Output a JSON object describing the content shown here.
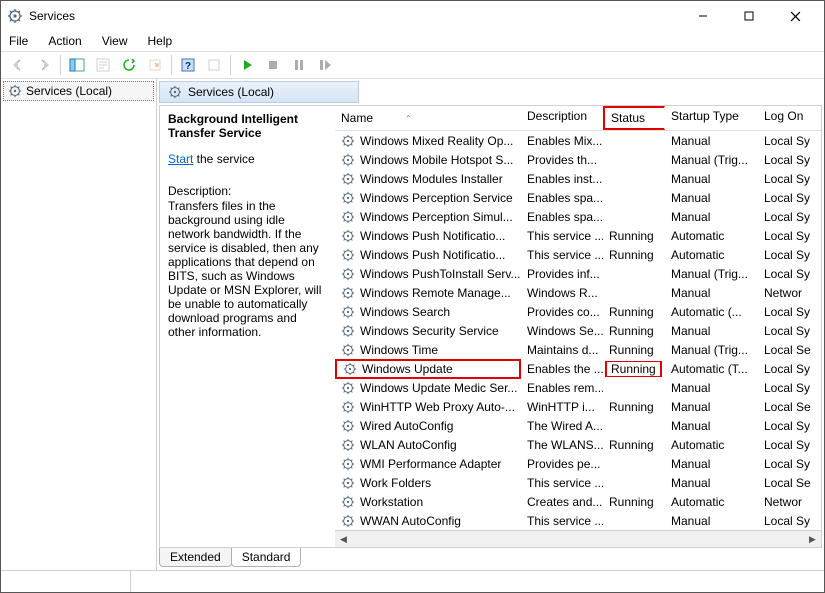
{
  "window": {
    "title": "Services"
  },
  "menu": {
    "file": "File",
    "action": "Action",
    "view": "View",
    "help": "Help"
  },
  "left": {
    "label": "Services (Local)"
  },
  "pane_header": "Services (Local)",
  "detail": {
    "service_name": "Background Intelligent Transfer Service",
    "start_link": "Start",
    "start_suffix": " the service",
    "desc_label": "Description:",
    "desc_text": "Transfers files in the background using idle network bandwidth. If the service is disabled, then any applications that depend on BITS, such as Windows Update or MSN Explorer, will be unable to automatically download programs and other information."
  },
  "columns": {
    "name": "Name",
    "desc": "Description",
    "status": "Status",
    "stype": "Startup Type",
    "logon": "Log On"
  },
  "rows": [
    {
      "name": "Windows Mixed Reality Op...",
      "desc": "Enables Mix...",
      "status": "",
      "stype": "Manual",
      "logon": "Local Sy"
    },
    {
      "name": "Windows Mobile Hotspot S...",
      "desc": "Provides th...",
      "status": "",
      "stype": "Manual (Trig...",
      "logon": "Local Sy"
    },
    {
      "name": "Windows Modules Installer",
      "desc": "Enables inst...",
      "status": "",
      "stype": "Manual",
      "logon": "Local Sy"
    },
    {
      "name": "Windows Perception Service",
      "desc": "Enables spa...",
      "status": "",
      "stype": "Manual",
      "logon": "Local Sy"
    },
    {
      "name": "Windows Perception Simul...",
      "desc": "Enables spa...",
      "status": "",
      "stype": "Manual",
      "logon": "Local Sy"
    },
    {
      "name": "Windows Push Notificatio...",
      "desc": "This service ...",
      "status": "Running",
      "stype": "Automatic",
      "logon": "Local Sy"
    },
    {
      "name": "Windows Push Notificatio...",
      "desc": "This service ...",
      "status": "Running",
      "stype": "Automatic",
      "logon": "Local Sy"
    },
    {
      "name": "Windows PushToInstall Serv...",
      "desc": "Provides inf...",
      "status": "",
      "stype": "Manual (Trig...",
      "logon": "Local Sy"
    },
    {
      "name": "Windows Remote Manage...",
      "desc": "Windows R...",
      "status": "",
      "stype": "Manual",
      "logon": "Networ"
    },
    {
      "name": "Windows Search",
      "desc": "Provides co...",
      "status": "Running",
      "stype": "Automatic (...",
      "logon": "Local Sy"
    },
    {
      "name": "Windows Security Service",
      "desc": "Windows Se...",
      "status": "Running",
      "stype": "Manual",
      "logon": "Local Sy"
    },
    {
      "name": "Windows Time",
      "desc": "Maintains d...",
      "status": "Running",
      "stype": "Manual (Trig...",
      "logon": "Local Se"
    },
    {
      "name": "Windows Update",
      "desc": "Enables the ...",
      "status": "Running",
      "stype": "Automatic (T...",
      "logon": "Local Sy",
      "hi_name": true,
      "hi_status": true
    },
    {
      "name": "Windows Update Medic Ser...",
      "desc": "Enables rem...",
      "status": "",
      "stype": "Manual",
      "logon": "Local Sy"
    },
    {
      "name": "WinHTTP Web Proxy Auto-...",
      "desc": "WinHTTP i...",
      "status": "Running",
      "stype": "Manual",
      "logon": "Local Se"
    },
    {
      "name": "Wired AutoConfig",
      "desc": "The Wired A...",
      "status": "",
      "stype": "Manual",
      "logon": "Local Sy"
    },
    {
      "name": "WLAN AutoConfig",
      "desc": "The WLANS...",
      "status": "Running",
      "stype": "Automatic",
      "logon": "Local Sy"
    },
    {
      "name": "WMI Performance Adapter",
      "desc": "Provides pe...",
      "status": "",
      "stype": "Manual",
      "logon": "Local Sy"
    },
    {
      "name": "Work Folders",
      "desc": "This service ...",
      "status": "",
      "stype": "Manual",
      "logon": "Local Se"
    },
    {
      "name": "Workstation",
      "desc": "Creates and...",
      "status": "Running",
      "stype": "Automatic",
      "logon": "Networ"
    },
    {
      "name": "WWAN AutoConfig",
      "desc": "This service ...",
      "status": "",
      "stype": "Manual",
      "logon": "Local Sy"
    }
  ],
  "tabs": {
    "extended": "Extended",
    "standard": "Standard"
  }
}
